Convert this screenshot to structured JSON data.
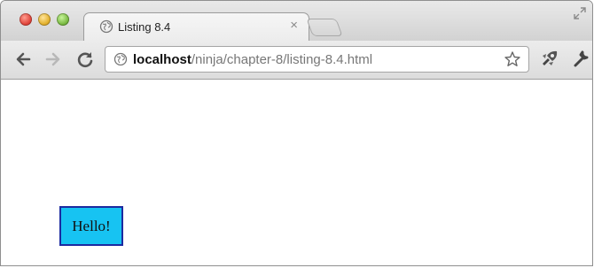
{
  "tab": {
    "title": "Listing 8.4",
    "close_glyph": "×"
  },
  "address_bar": {
    "host": "localhost",
    "path": "/ninja/chapter-8/listing-8.4.html"
  },
  "page": {
    "box_text": "Hello!"
  },
  "colors": {
    "box_fill": "#17c3f2",
    "box_border": "#1c2aa0"
  },
  "icons": [
    "globe-icon",
    "back-arrow-icon",
    "forward-arrow-icon",
    "reload-icon",
    "star-icon",
    "extension-icon",
    "wrench-icon",
    "fullscreen-icon"
  ]
}
